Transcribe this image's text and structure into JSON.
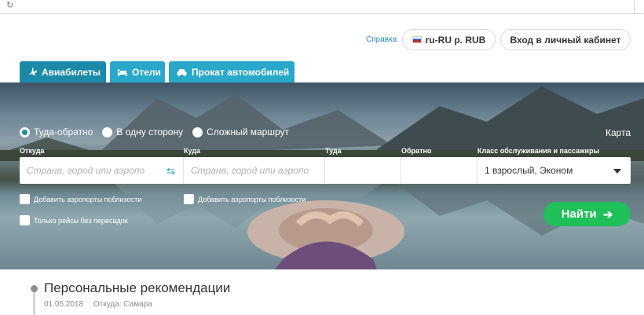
{
  "browser": {
    "reload_icon": "reload-icon"
  },
  "header": {
    "help": "Справка",
    "lang_currency": "ru-RU р. RUB",
    "login": "Вход в личный кабинет"
  },
  "tabs": [
    {
      "label": "Авиабилеты",
      "icon": "airplane-icon",
      "active": true
    },
    {
      "label": "Отели",
      "icon": "bed-icon",
      "active": false
    },
    {
      "label": "Прокат автомобилей",
      "icon": "car-icon",
      "active": false
    }
  ],
  "trip_types": [
    {
      "label": "Туда-обратно",
      "selected": true
    },
    {
      "label": "В одну сторону",
      "selected": false
    },
    {
      "label": "Сложный маршрут",
      "selected": false
    }
  ],
  "map_link": "Карта",
  "form": {
    "from_label": "Откуда",
    "from_placeholder": "Страна, город или аэропорт",
    "to_label": "Куда",
    "to_placeholder": "Страна, город или аэропорт",
    "depart_label": "Туда",
    "return_label": "Обратно",
    "class_label": "Класс обслуживания и пассажиры",
    "class_value": "1 взрослый, Эконом",
    "nearby_from": "Добавить аэропорты поблизости",
    "nearby_to": "Добавить аэропорты поблизости",
    "direct_only": "Только рейсы без пересадок",
    "search_label": "Найти"
  },
  "recommendations": {
    "title": "Персональные рекомендации",
    "date": "01.05.2018",
    "from": "Откуда: Самара"
  },
  "colors": {
    "tab": "#2aa8c9",
    "tab_active": "#1b8aa8",
    "search": "#1fbf5a",
    "link": "#2c86c9"
  }
}
